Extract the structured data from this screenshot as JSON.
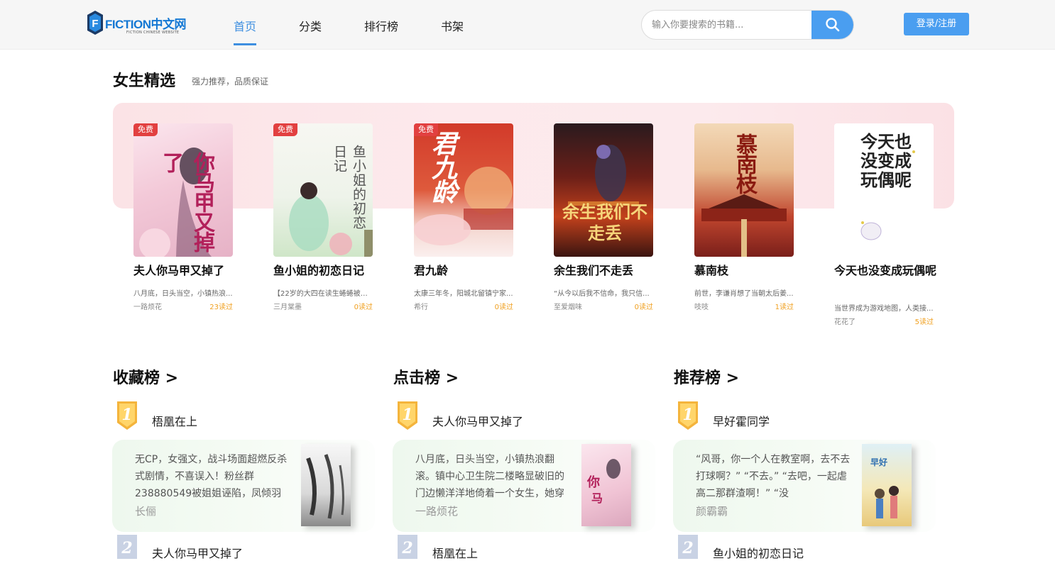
{
  "brand": {
    "logo_text": "FICTION中文网",
    "logo_sub": "FICTION CHINESE WEBSITE"
  },
  "nav": {
    "items": [
      {
        "label": "首页",
        "active": true
      },
      {
        "label": "分类"
      },
      {
        "label": "排行榜"
      },
      {
        "label": "书架"
      }
    ]
  },
  "search": {
    "placeholder": "输入你要搜索的书籍..."
  },
  "auth": {
    "login_label": "登录/注册"
  },
  "accent": "#4a9ef0",
  "featured": {
    "title": "女生精选",
    "subtitle": "强力推荐，品质保证",
    "books": [
      {
        "name": "夫人你马甲又掉了",
        "desc": "八月底，日头当空，小镇热浪...",
        "author": "一路烦花",
        "reads": "23读过",
        "badge": "免费",
        "cover_text": "你马甲又掉了"
      },
      {
        "name": "鱼小姐的初恋日记",
        "desc": "【22岁的大四在读生蜷蜷被催...",
        "author": "三月棠墨",
        "reads": "0读过",
        "badge": "免费",
        "cover_text": "鱼小姐的初恋日记"
      },
      {
        "name": "君九龄",
        "desc": "太康三年冬，阳城北留镇宁家...",
        "author": "希行",
        "reads": "0读过",
        "badge": "免费",
        "cover_text": "君九龄"
      },
      {
        "name": "余生我们不走丢",
        "desc": "“从今以后我不信命，我只信...",
        "author": "至爱烟味",
        "reads": "0读过",
        "badge": "",
        "cover_text": "余生我们不走丢"
      },
      {
        "name": "慕南枝",
        "desc": "前世，李谦肖想了当朝太后姜...",
        "author": "吱吱",
        "reads": "1读过",
        "badge": "",
        "cover_text": "慕南枝"
      },
      {
        "name": "今天也没变成玩偶呢",
        "desc": "当世界成为游戏地图，人类接...",
        "author": "花花了",
        "reads": "5读过",
        "badge": "",
        "cover_text": "今天也没变成玩偶呢"
      }
    ]
  },
  "rankings": [
    {
      "title": "收藏榜 >",
      "first": {
        "rank": "1",
        "name": "梧凰在上",
        "desc": "无CP，女强文，战斗场面超燃反杀式剧情，不喜误入！粉丝群238880549被姐姐诬陷，凤倾羽",
        "author": "长俪"
      },
      "second": {
        "rank": "2",
        "name": "夫人你马甲又掉了"
      }
    },
    {
      "title": "点击榜 >",
      "first": {
        "rank": "1",
        "name": "夫人你马甲又掉了",
        "desc": "八月底，日头当空，小镇热浪翻滚。镇中心卫生院二楼略显破旧的门边懒洋洋地倚着一个女生，她穿",
        "author": "一路烦花"
      },
      "second": {
        "rank": "2",
        "name": "梧凰在上"
      }
    },
    {
      "title": "推荐榜 >",
      "first": {
        "rank": "1",
        "name": "早好霍同学",
        "desc": "“风哥，你一个人在教室啊，去不去打球啊？” “不去。” “去吧，一起虐高二那群渣啊！” “没",
        "author": "颜霸霸"
      },
      "second": {
        "rank": "2",
        "name": "鱼小姐的初恋日记"
      }
    }
  ],
  "icons": {
    "search": "search-icon",
    "medal": "medal-icon"
  }
}
